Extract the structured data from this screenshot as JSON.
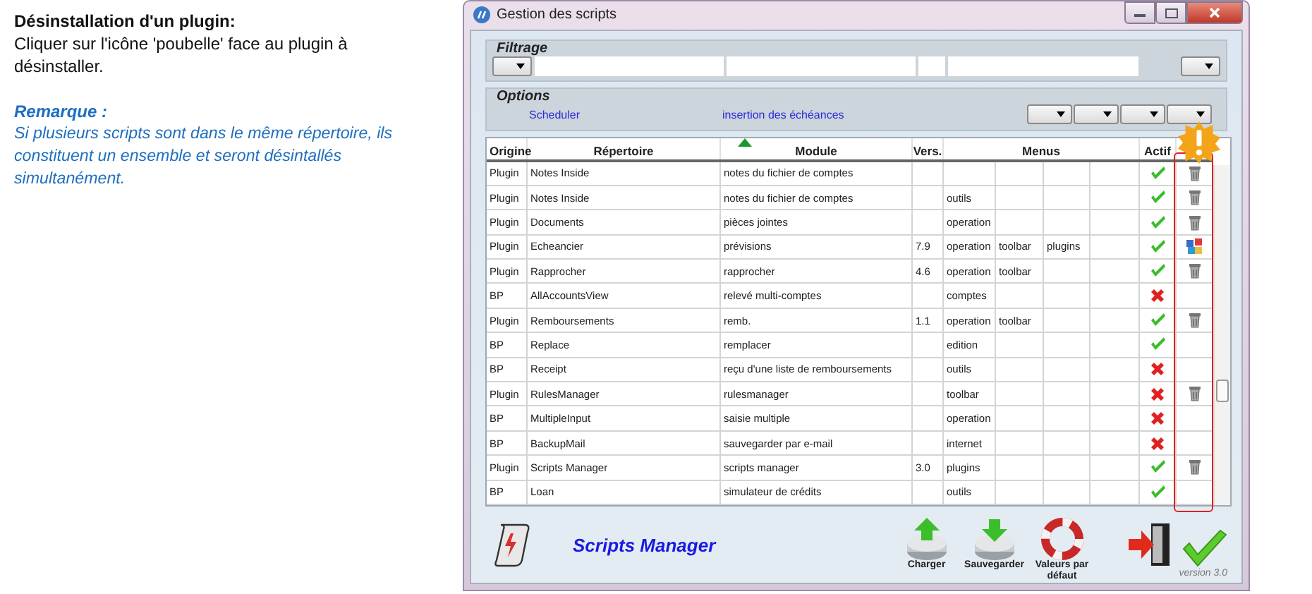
{
  "instructions": {
    "heading": "Désinstallation d'un plugin:",
    "body": "Cliquer sur l'icône 'poubelle' face au plugin à désinstaller.",
    "note_title": "Remarque :",
    "note": "Si plusieurs scripts sont dans le même répertoire, ils  constituent un ensemble et seront désintallés simultanément."
  },
  "window": {
    "title": "Gestion des scripts"
  },
  "filter": {
    "title": "Filtrage"
  },
  "options": {
    "title": "Options",
    "links": [
      "Scheduler",
      "insertion des échéances"
    ]
  },
  "table": {
    "columns": [
      {
        "label": "Origine"
      },
      {
        "label": "Répertoire"
      },
      {
        "label": "Module",
        "sorted": true
      },
      {
        "label": "Vers."
      },
      {
        "label": "Menus"
      },
      {
        "label": "Actif"
      }
    ],
    "rows": [
      {
        "origin": "Plugin",
        "folder": "Notes Inside",
        "module": "notes du fichier de comptes",
        "menus": [],
        "active": true,
        "kind": "removable"
      },
      {
        "origin": "Plugin",
        "folder": "Notes Inside",
        "module": "notes du fichier de comptes",
        "menus": [
          "outils"
        ],
        "active": true,
        "kind": "removable"
      },
      {
        "origin": "Plugin",
        "folder": "Documents",
        "module": "pièces jointes",
        "menus": [
          "operation"
        ],
        "active": true,
        "kind": "removable"
      },
      {
        "origin": "Plugin",
        "folder": "Echeancier",
        "module": "prévisions",
        "version": "7.9",
        "menus": [
          "operation",
          "toolbar",
          "plugins"
        ],
        "active": true,
        "kind": "tiles"
      },
      {
        "origin": "Plugin",
        "folder": "Rapprocher",
        "module": "rapprocher",
        "version": "4.6",
        "menus": [
          "operation",
          "toolbar"
        ],
        "active": true,
        "kind": "removable"
      },
      {
        "origin": "BP",
        "folder": "AllAccountsView",
        "module": "relevé multi-comptes",
        "menus": [
          "comptes"
        ],
        "active": false,
        "kind": "fixed"
      },
      {
        "origin": "Plugin",
        "folder": "Remboursements",
        "module": "remb.",
        "version": "1.1",
        "menus": [
          "operation",
          "toolbar"
        ],
        "active": true,
        "kind": "removable"
      },
      {
        "origin": "BP",
        "folder": "Replace",
        "module": "remplacer",
        "menus": [
          "edition"
        ],
        "active": true,
        "kind": "fixed"
      },
      {
        "origin": "BP",
        "folder": "Receipt",
        "module": "reçu d'une liste de remboursements",
        "menus": [
          "outils"
        ],
        "active": false,
        "kind": "fixed"
      },
      {
        "origin": "Plugin",
        "folder": "RulesManager",
        "module": "rulesmanager",
        "menus": [
          "toolbar"
        ],
        "active": false,
        "kind": "removable"
      },
      {
        "origin": "BP",
        "folder": "MultipleInput",
        "module": "saisie multiple",
        "menus": [
          "operation"
        ],
        "active": false,
        "kind": "fixed"
      },
      {
        "origin": "BP",
        "folder": "BackupMail",
        "module": "sauvegarder par e-mail",
        "menus": [
          "internet"
        ],
        "active": false,
        "kind": "fixed"
      },
      {
        "origin": "Plugin",
        "folder": "Scripts Manager",
        "module": "scripts manager",
        "version": "3.0",
        "menus": [
          "plugins"
        ],
        "active": true,
        "kind": "removable"
      },
      {
        "origin": "BP",
        "folder": "Loan",
        "module": "simulateur de crédits",
        "menus": [
          "outils"
        ],
        "active": true,
        "kind": "fixed"
      }
    ]
  },
  "footer": {
    "app_name": "Scripts Manager",
    "buttons": [
      {
        "kind": "load",
        "label": "Charger"
      },
      {
        "kind": "save",
        "label": "Sauvegarder"
      },
      {
        "kind": "defaults",
        "label": "Valeurs par défaut"
      }
    ],
    "version": "version 3.0"
  }
}
